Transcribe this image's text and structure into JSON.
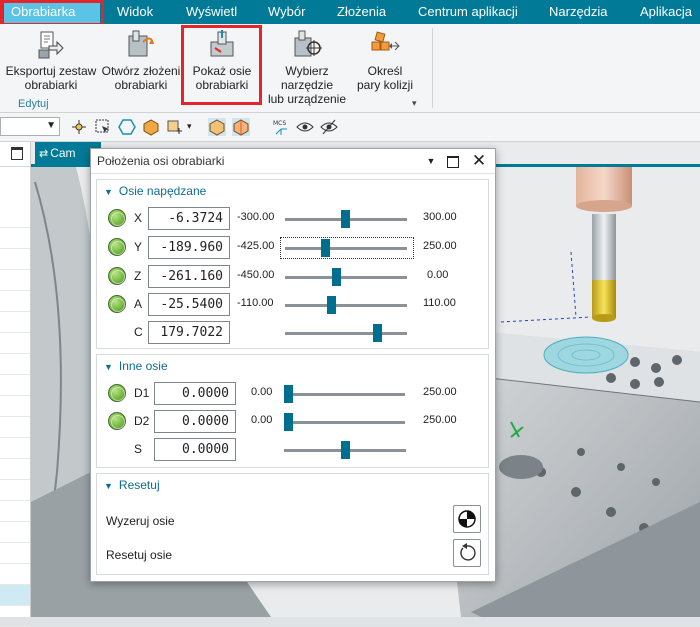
{
  "menu": {
    "items": [
      {
        "label": "Obrabiarka",
        "active": true
      },
      {
        "label": "Widok"
      },
      {
        "label": "Wyświetl"
      },
      {
        "label": "Wybór"
      },
      {
        "label": "Złożenia"
      },
      {
        "label": "Centrum aplikacji"
      },
      {
        "label": "Narzędzia"
      },
      {
        "label": "Aplikacja"
      }
    ]
  },
  "ribbon": {
    "buttons": [
      {
        "line1": "Eksportuj zestaw",
        "line2": "obrabiarki"
      },
      {
        "line1": "Otwórz złożeni",
        "line2": "obrabiarki"
      },
      {
        "line1": "Pokaż osie",
        "line2": "obrabiarki"
      },
      {
        "line1": "Wybierz narzędzie",
        "line2": "lub urządzenie"
      },
      {
        "line1": "Określ",
        "line2": "pary kolizji"
      }
    ],
    "group_label": "Edytuj"
  },
  "viewport": {
    "tab_label": "Cam"
  },
  "dialog": {
    "title": "Położenia osi obrabiarki",
    "driven": {
      "heading": "Osie napędzane",
      "axes": [
        {
          "name": "X",
          "value": "-6.3724",
          "min": "-300.00",
          "max": "300.00",
          "pos": 0.49
        },
        {
          "name": "Y",
          "value": "-189.960",
          "min": "-425.00",
          "max": "250.00",
          "pos": 0.33
        },
        {
          "name": "Z",
          "value": "-261.160",
          "min": "-450.00",
          "max": "0.00",
          "pos": 0.42
        },
        {
          "name": "A",
          "value": "-25.5400",
          "min": "-110.00",
          "max": "110.00",
          "pos": 0.38
        },
        {
          "name": "C",
          "value": "179.7022",
          "pos": 0.75
        }
      ]
    },
    "other": {
      "heading": "Inne osie",
      "axes": [
        {
          "name": "D1",
          "value": "0.0000",
          "min": "0.00",
          "max": "250.00",
          "pos": 0.0
        },
        {
          "name": "D2",
          "value": "0.0000",
          "min": "0.00",
          "max": "250.00",
          "pos": 0.0
        },
        {
          "name": "S",
          "value": "0.0000",
          "pos": 0.5
        }
      ]
    },
    "reset": {
      "heading": "Resetuj",
      "zero_label": "Wyzeruj osie",
      "reset_label": "Resetuj osie"
    }
  },
  "colors": {
    "accent": "#007a96",
    "highlight": "#e3262b",
    "active_tab": "#5bc4e6",
    "thumb": "#006f8f"
  }
}
